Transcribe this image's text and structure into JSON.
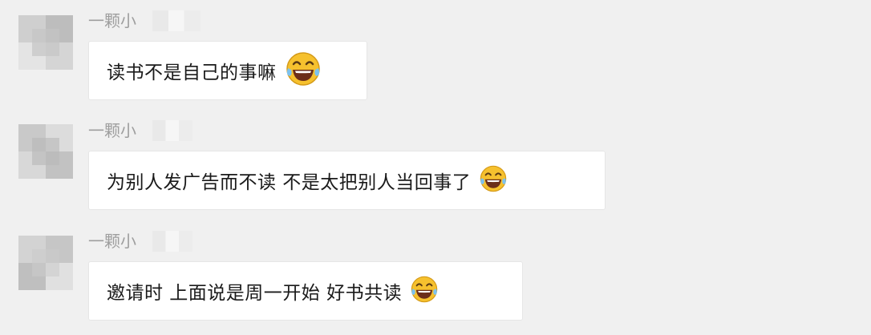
{
  "messages": [
    {
      "sender": "一颗小",
      "text": "读书不是自己的事嘛",
      "emoji": "laughing-tears-emoji"
    },
    {
      "sender": "一颗小",
      "text": "为别人发广告而不读 不是太把别人当回事了",
      "emoji": "laughing-tears-emoji"
    },
    {
      "sender": "一颗小",
      "text": "邀请时 上面说是周一开始 好书共读",
      "emoji": "laughing-tears-emoji"
    }
  ],
  "colors": {
    "background": "#f0f0f0",
    "bubble": "#ffffff",
    "sender_text": "#9e9e9e",
    "message_text": "#1a1a1a",
    "emoji_face": "#f6c12e"
  }
}
